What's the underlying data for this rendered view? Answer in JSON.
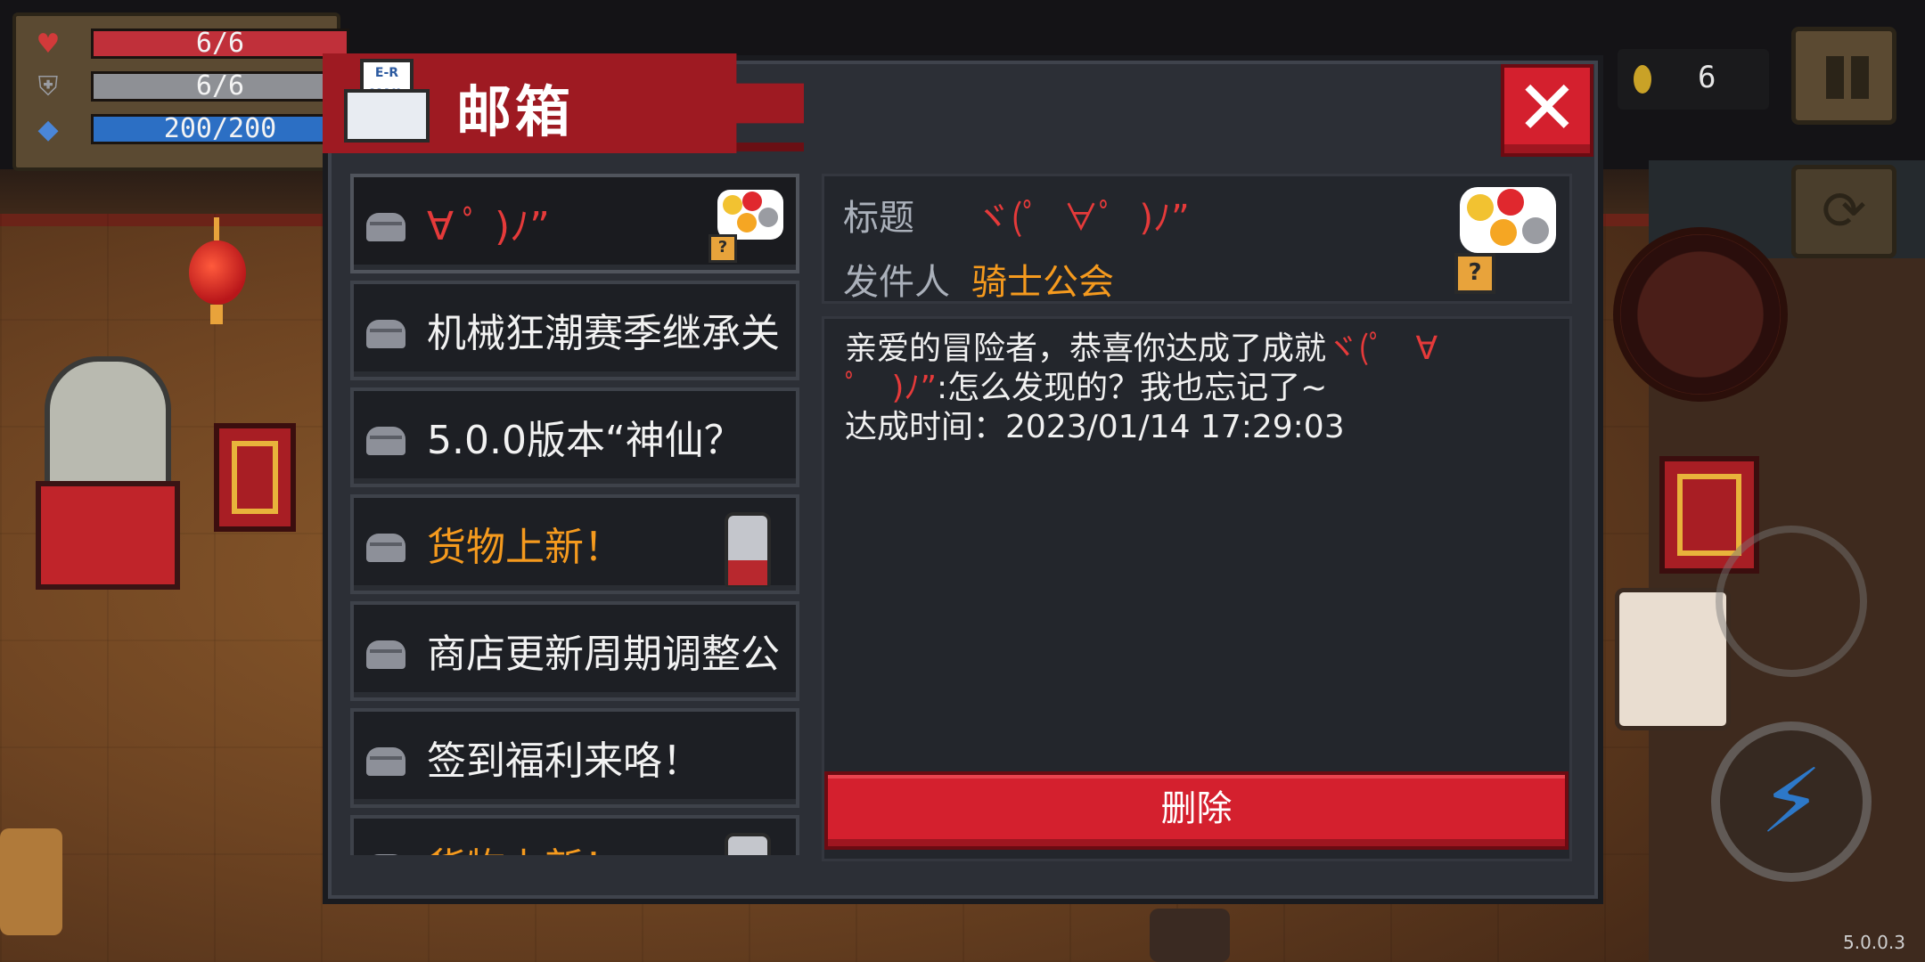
{
  "hud": {
    "health": {
      "text": "6/6",
      "fill": 1.0,
      "color": "#c0303a",
      "icon": "heart-icon"
    },
    "armor": {
      "text": "6/6",
      "fill": 1.0,
      "color": "#8e9095",
      "icon": "shield-icon"
    },
    "energy": {
      "text": "200/200",
      "fill": 1.0,
      "color": "#2c6fc4",
      "icon": "energy-gem-icon"
    },
    "coins": "6",
    "version": "5.0.0.3"
  },
  "mailbox": {
    "title": "邮箱",
    "icon_text": "E-R\nMAIL",
    "items": [
      {
        "title": "∀ ﾟ  )ﾉ”",
        "style": "red",
        "thumb": "emoji",
        "selected": true
      },
      {
        "title": "机械狂潮赛季继承关",
        "style": "white"
      },
      {
        "title": "5.0.0版本“神仙？",
        "style": "white"
      },
      {
        "title": "货物上新！",
        "style": "orange",
        "thumb": "character"
      },
      {
        "title": "商店更新周期调整公",
        "style": "white"
      },
      {
        "title": "签到福利来咯！",
        "style": "white"
      },
      {
        "title": "货物上新！",
        "style": "orange",
        "thumb": "character"
      }
    ],
    "detail": {
      "subject_label": "标题",
      "subject_value": "ヾ(ﾟ  ∀ﾟ  )ﾉ”",
      "sender_label": "发件人",
      "sender_value": "骑士公会",
      "body_part1": "亲爱的冒险者，恭喜你达成了成就",
      "body_emote": "ヾ(ﾟ   ∀\nﾟ   )ﾉ”",
      "body_part2": ":怎么发现的？我也忘记了~",
      "body_line3": "达成时间：2023/01/14 17:29:03"
    },
    "delete_label": "删除"
  }
}
